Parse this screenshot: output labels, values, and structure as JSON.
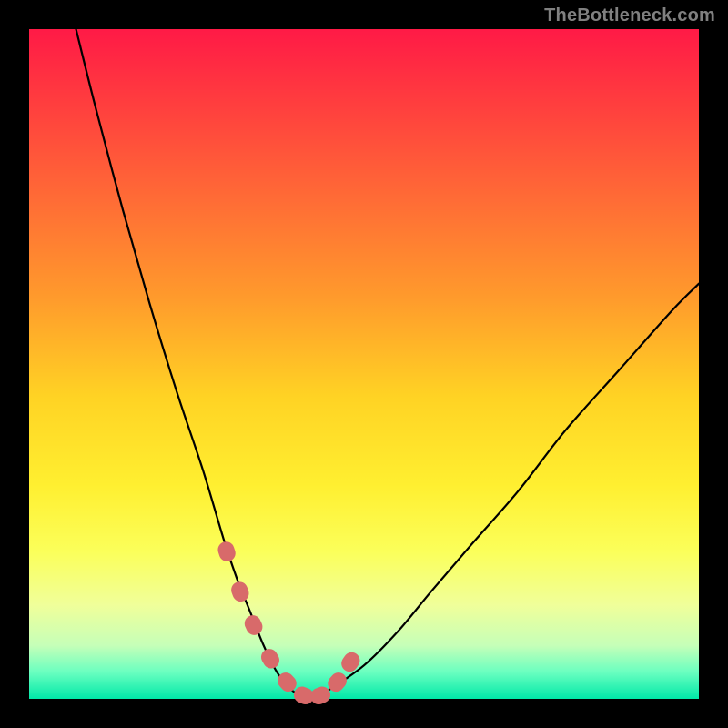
{
  "watermark": "TheBottleneck.com",
  "colors": {
    "background": "#000000",
    "curve": "#000000",
    "markers": "#d86a6a",
    "gradient_top": "#ff1a46",
    "gradient_bottom": "#00e8a8"
  },
  "chart_data": {
    "type": "line",
    "title": "",
    "xlabel": "",
    "ylabel": "",
    "xlim": [
      0,
      100
    ],
    "ylim": [
      0,
      100
    ],
    "series": [
      {
        "name": "bottleneck-curve",
        "x": [
          7,
          10,
          14,
          18,
          22,
          26,
          29,
          31,
          33,
          35,
          37,
          39,
          41,
          43,
          45,
          50,
          55,
          60,
          66,
          73,
          80,
          88,
          96,
          100
        ],
        "y": [
          100,
          88,
          73,
          59,
          46,
          34,
          24,
          18,
          13,
          8,
          4,
          1.5,
          0.3,
          0.3,
          1.5,
          5,
          10,
          16,
          23,
          31,
          40,
          49,
          58,
          62
        ]
      }
    ],
    "markers": {
      "name": "highlight-points",
      "x": [
        29.5,
        31.5,
        33.5,
        36.0,
        38.5,
        41.0,
        43.5,
        46.0,
        48.0
      ],
      "y": [
        22,
        16,
        11,
        6,
        2.5,
        0.5,
        0.5,
        2.5,
        5.5
      ]
    }
  }
}
